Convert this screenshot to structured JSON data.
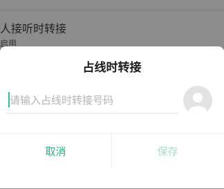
{
  "background": {
    "row_title": "人接听时转接",
    "row_subtitle": "启用"
  },
  "dialog": {
    "title": "占线时转接",
    "input": {
      "value": "",
      "placeholder": "请输入占线时转接号码"
    },
    "contact_icon": "contact-avatar-icon",
    "cancel_label": "取消",
    "save_label": "保存"
  },
  "colors": {
    "accent": "#27b57f",
    "accent_disabled": "#a8dcc6",
    "cursor": "#27c58a",
    "overlay": "#8c8c8c"
  }
}
